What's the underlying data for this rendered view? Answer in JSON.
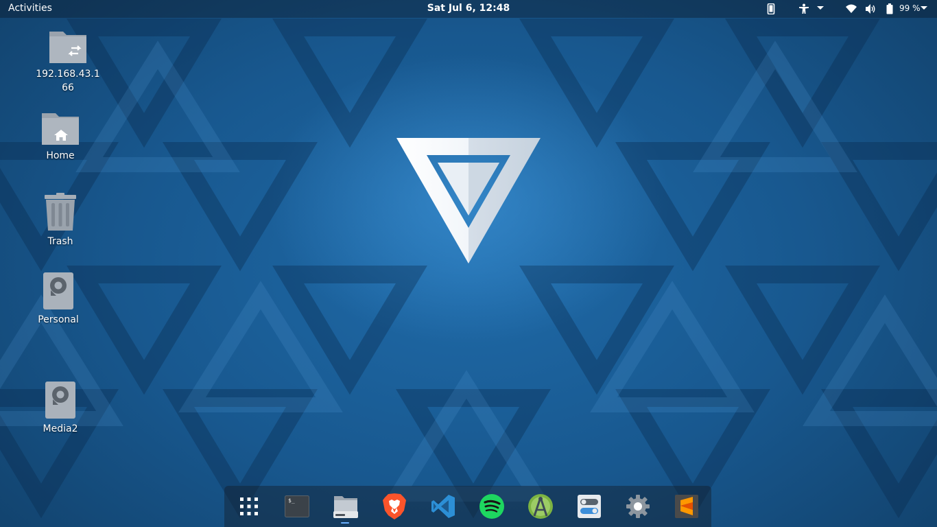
{
  "topbar": {
    "activities_label": "Activities",
    "clock": "Sat Jul  6, 12:48",
    "battery_percent": "99 %",
    "tray_icons": [
      "phone-icon",
      "accessibility-icon",
      "wifi-icon",
      "volume-icon",
      "battery-icon"
    ]
  },
  "desktop": {
    "icons": [
      {
        "name": "network-share",
        "label": "192.168.43.166",
        "icon": "network-folder-icon"
      },
      {
        "name": "home",
        "label": "Home",
        "icon": "home-folder-icon"
      },
      {
        "name": "trash",
        "label": "Trash",
        "icon": "trash-icon"
      },
      {
        "name": "personal",
        "label": "Personal",
        "icon": "drive-icon"
      },
      {
        "name": "media2",
        "label": "Media2",
        "icon": "drive-icon"
      }
    ]
  },
  "dock": {
    "items": [
      {
        "name": "show-applications",
        "icon": "app-grid-icon"
      },
      {
        "name": "terminal",
        "icon": "terminal-icon"
      },
      {
        "name": "files",
        "icon": "files-icon",
        "running": true
      },
      {
        "name": "brave",
        "icon": "brave-lion-icon"
      },
      {
        "name": "vscode",
        "icon": "vscode-icon"
      },
      {
        "name": "spotify",
        "icon": "spotify-icon"
      },
      {
        "name": "android-studio",
        "icon": "android-studio-icon"
      },
      {
        "name": "tweaks",
        "icon": "toggle-switch-icon"
      },
      {
        "name": "settings",
        "icon": "gear-icon"
      },
      {
        "name": "sublime-text",
        "icon": "sublime-text-icon"
      }
    ]
  },
  "colors": {
    "wallpaper_base": "#1c5a8e",
    "topbar_text": "#ffffff",
    "running_indicator": "#6ab0ff"
  }
}
